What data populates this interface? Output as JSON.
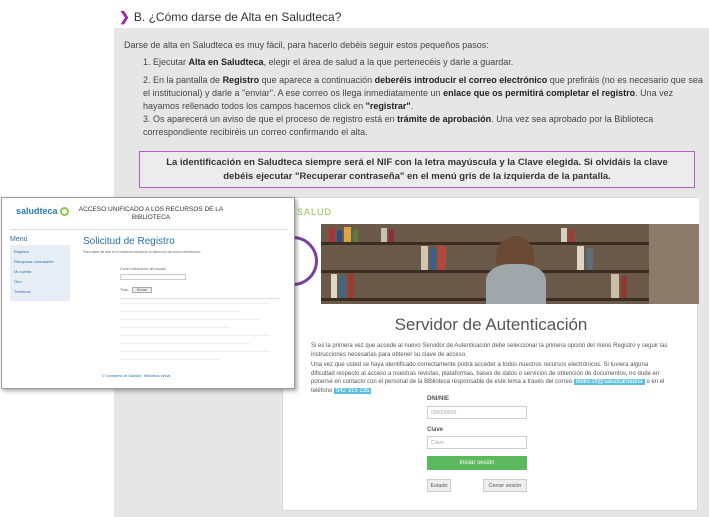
{
  "section": {
    "title": "B. ¿Cómo darse de Alta en Saludteca?",
    "intro": "Darse de alta en Saludteca es muy fácil, para hacerlo debéis seguir estos pequeños pasos:",
    "steps": [
      {
        "pre": "1. Ejecutar ",
        "bold": "Alta en Saludteca",
        "post": ", elegir el área de salud a la que pertenecéis y darle a guardar."
      },
      {
        "pre": "2. En la pantalla de ",
        "bold1": "Registro",
        "mid1": " que aparece a continuación ",
        "bold2": "deberéis introducir el correo electrónico",
        "mid2": " que prefiráis (no es necesario que sea el institucional) y darle a \"enviar\". A ese correo os llega inmediatamente un ",
        "bold3": "enlace que os permitirá completar el registro",
        "mid3": ". Una vez hayamos rellenado todos los campos hacemos click en ",
        "bold4": "\"registrar\"",
        "post": "."
      },
      {
        "pre": "3. Os aparecerá un aviso de que el proceso de registro está en ",
        "bold": "trámite de aprobación",
        "post": ". Una vez sea aprobado por la Biblioteca correspondiente recibiréis un correo confirmando el alta."
      }
    ],
    "notice": "La identificación en Saludteca siempre será el NIF con la letra mayúscula y la Clave elegida. Si olvidáis la clave debéis ejecutar \"Recuperar contraseña\" en el menú gris de la izquierda de la pantalla."
  },
  "auth_page": {
    "brand_fragment": "SALUD",
    "title": "Servidor de Autenticación",
    "para1": "Si es la primera vez que accede al nuevo Servidor de Autenticación debe seleccionar la primera opción del menú Registro y seguir las instrucciones necesarias para obtener su clave de acceso.",
    "para2": "Una vez que usted se haya identificado correctamente podrá acceder a todos nuestros recursos electrónicos. Si tuviera alguna dificultad respecto al acceso a nuestras revistas, plataformas, bases de datos o servicios de obtención de documentos, no dude en ponerse en contacto con el personal de la Biblioteca responsable de este tema a través del correo",
    "email": "biblio.sfl@saludcantabria",
    "phone_prefix": "o en el teléfono",
    "phone": "942 315 135",
    "dni_label": "DNI/NIE",
    "dni_placeholder": "00000000X",
    "clave_label": "Clave",
    "clave_placeholder": "Clave",
    "login_button": "Iniciar sesión",
    "estado_button": "Estado",
    "cerrar_button": "Cerrar sesión"
  },
  "reg_page": {
    "logo": "saludteca",
    "header": "ACCESO UNIFICADO A LOS RECURSOS DE LA BIBLIOTECA",
    "menu_title": "Menú",
    "menu_items": [
      "Registro",
      "Recuperar contraseña",
      "Mi cuenta",
      "Otro",
      "Términos"
    ],
    "title": "Solicitud de Registro",
    "body": "Para darte de alta en el sistema introduce tu dirección de correo electrónico.",
    "email_label": "Correo electrónico de usuario",
    "captcha_label": "Texto",
    "send_button": "Enviar",
    "footer": "© Consejería de Sanidad · Biblioteca Virtual"
  }
}
